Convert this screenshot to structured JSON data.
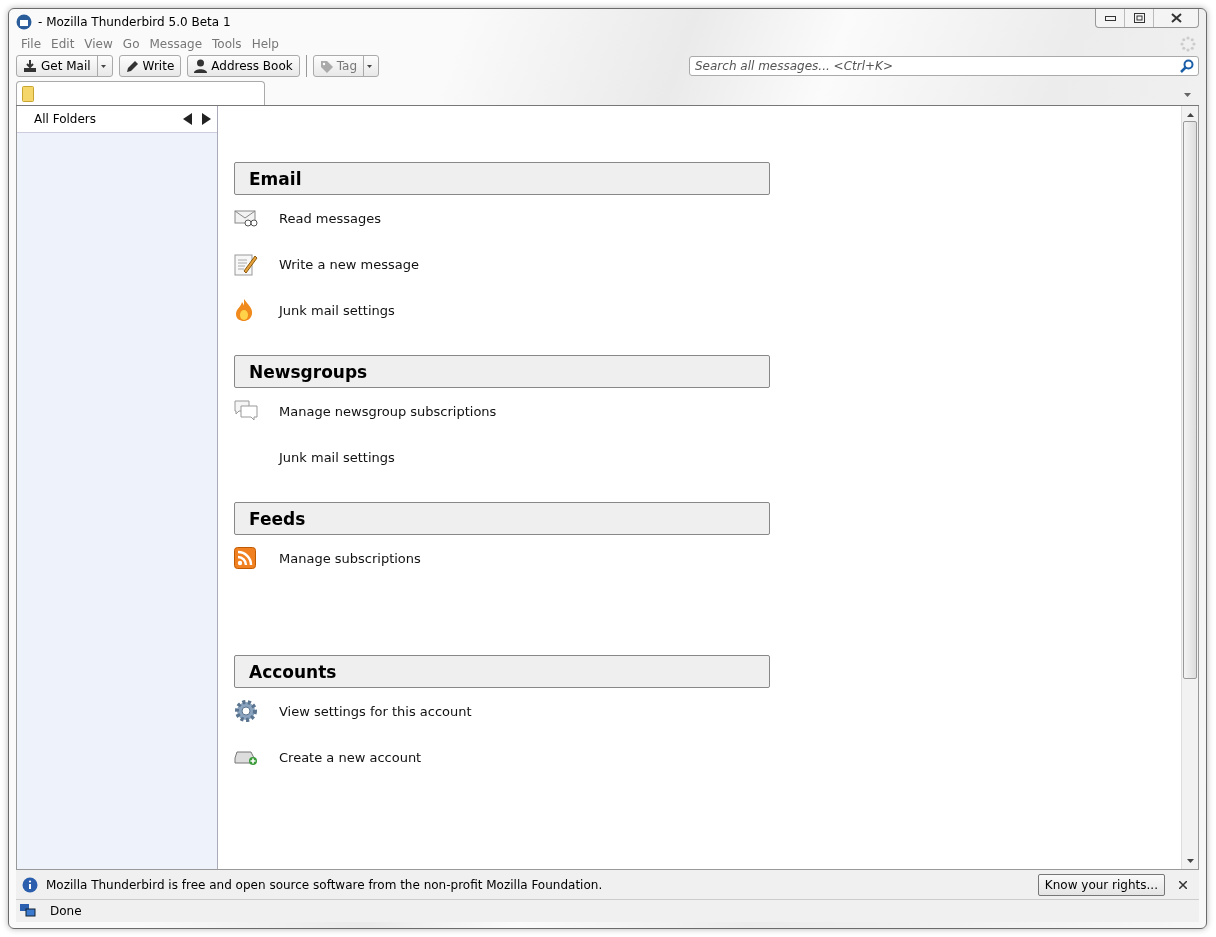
{
  "window": {
    "title": "- Mozilla Thunderbird 5.0 Beta 1"
  },
  "menu": [
    "File",
    "Edit",
    "View",
    "Go",
    "Message",
    "Tools",
    "Help"
  ],
  "toolbar": {
    "buttons": [
      {
        "label": "Get Mail",
        "kind": "getmail"
      },
      {
        "label": "Write",
        "kind": "write"
      },
      {
        "label": "Address Book",
        "kind": "addressbook"
      },
      {
        "label": "Tag",
        "kind": "tag"
      }
    ],
    "search": {
      "placeholder": "Search all messages... <Ctrl+K>"
    }
  },
  "folder_pane": {
    "title": "All Folders"
  },
  "sections": [
    {
      "title": "Email",
      "items": [
        {
          "label": "Read messages",
          "kind": "read"
        },
        {
          "label": "Write a new message",
          "kind": "write"
        },
        {
          "label": "Junk mail settings",
          "kind": "junk"
        }
      ]
    },
    {
      "title": "Newsgroups",
      "items": [
        {
          "label": "Manage newsgroup subscriptions",
          "kind": "newsgroups"
        },
        {
          "label": "Junk mail settings",
          "kind": "plain"
        }
      ]
    },
    {
      "title": "Feeds",
      "items": [
        {
          "label": "Manage subscriptions",
          "kind": "feeds"
        }
      ]
    },
    {
      "title": "Accounts",
      "items": [
        {
          "label": "View settings for this account",
          "kind": "settings"
        },
        {
          "label": "Create a new account",
          "kind": "newaccount"
        }
      ]
    }
  ],
  "notification": {
    "text": "Mozilla Thunderbird is free and open source software from the non-profit Mozilla Foundation.",
    "button": "Know your rights..."
  },
  "status_bar": {
    "text": "Done"
  }
}
